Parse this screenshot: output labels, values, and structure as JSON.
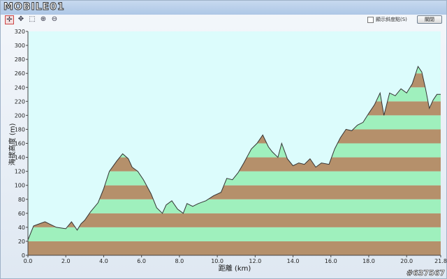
{
  "app": {
    "logo_text": "MOBILE01",
    "toolbar_icons": [
      "crosshair-icon",
      "pan-icon",
      "select-icon",
      "zoom-in-icon",
      "zoom-out-icon"
    ],
    "show_slope_label": "顯示斜度點(S)",
    "close_label": "關閉",
    "watermark": "#637567"
  },
  "chart_data": {
    "type": "area",
    "xlabel": "距離  (km)",
    "ylabel": "海拔高度 (m)",
    "xlim": [
      0,
      21.8
    ],
    "ylim": [
      0,
      320
    ],
    "xticks": [
      "0.0",
      "2.0",
      "4.0",
      "6.0",
      "8.0",
      "10.0",
      "12.0",
      "14.0",
      "16.0",
      "18.0",
      "20.0",
      "21.8"
    ],
    "yticks": [
      "0",
      "20",
      "40",
      "60",
      "80",
      "100",
      "120",
      "140",
      "160",
      "180",
      "200",
      "220",
      "240",
      "260",
      "280",
      "300",
      "320"
    ],
    "band_height": 20,
    "colors": {
      "sky": "#dcfcfc",
      "band_light": "#9ff0bd",
      "band_dark": "#b5906b",
      "outline": "#333333"
    },
    "x": [
      0.0,
      0.3,
      0.6,
      0.9,
      1.2,
      1.5,
      2.0,
      2.3,
      2.6,
      2.8,
      3.0,
      3.3,
      3.7,
      4.0,
      4.3,
      4.7,
      5.0,
      5.3,
      5.5,
      5.8,
      6.1,
      6.5,
      6.8,
      7.1,
      7.3,
      7.6,
      7.9,
      8.2,
      8.4,
      8.7,
      9.0,
      9.4,
      9.8,
      10.2,
      10.5,
      10.8,
      11.1,
      11.4,
      11.8,
      12.1,
      12.4,
      12.7,
      12.9,
      13.2,
      13.4,
      13.7,
      14.0,
      14.3,
      14.6,
      14.9,
      15.2,
      15.5,
      15.9,
      16.2,
      16.5,
      16.8,
      17.1,
      17.4,
      17.7,
      18.0,
      18.3,
      18.6,
      18.8,
      19.1,
      19.4,
      19.7,
      20.0,
      20.3,
      20.6,
      20.8,
      21.0,
      21.2,
      21.4,
      21.6,
      21.8
    ],
    "y": [
      22,
      42,
      45,
      48,
      44,
      40,
      38,
      48,
      36,
      45,
      50,
      62,
      75,
      95,
      120,
      135,
      145,
      138,
      126,
      120,
      108,
      88,
      68,
      60,
      72,
      78,
      66,
      60,
      74,
      70,
      74,
      78,
      85,
      90,
      110,
      108,
      118,
      132,
      152,
      160,
      172,
      155,
      148,
      140,
      160,
      138,
      128,
      132,
      130,
      138,
      126,
      132,
      130,
      152,
      168,
      180,
      178,
      186,
      190,
      203,
      215,
      232,
      200,
      232,
      228,
      238,
      232,
      245,
      270,
      262,
      238,
      210,
      222,
      230,
      230
    ]
  }
}
